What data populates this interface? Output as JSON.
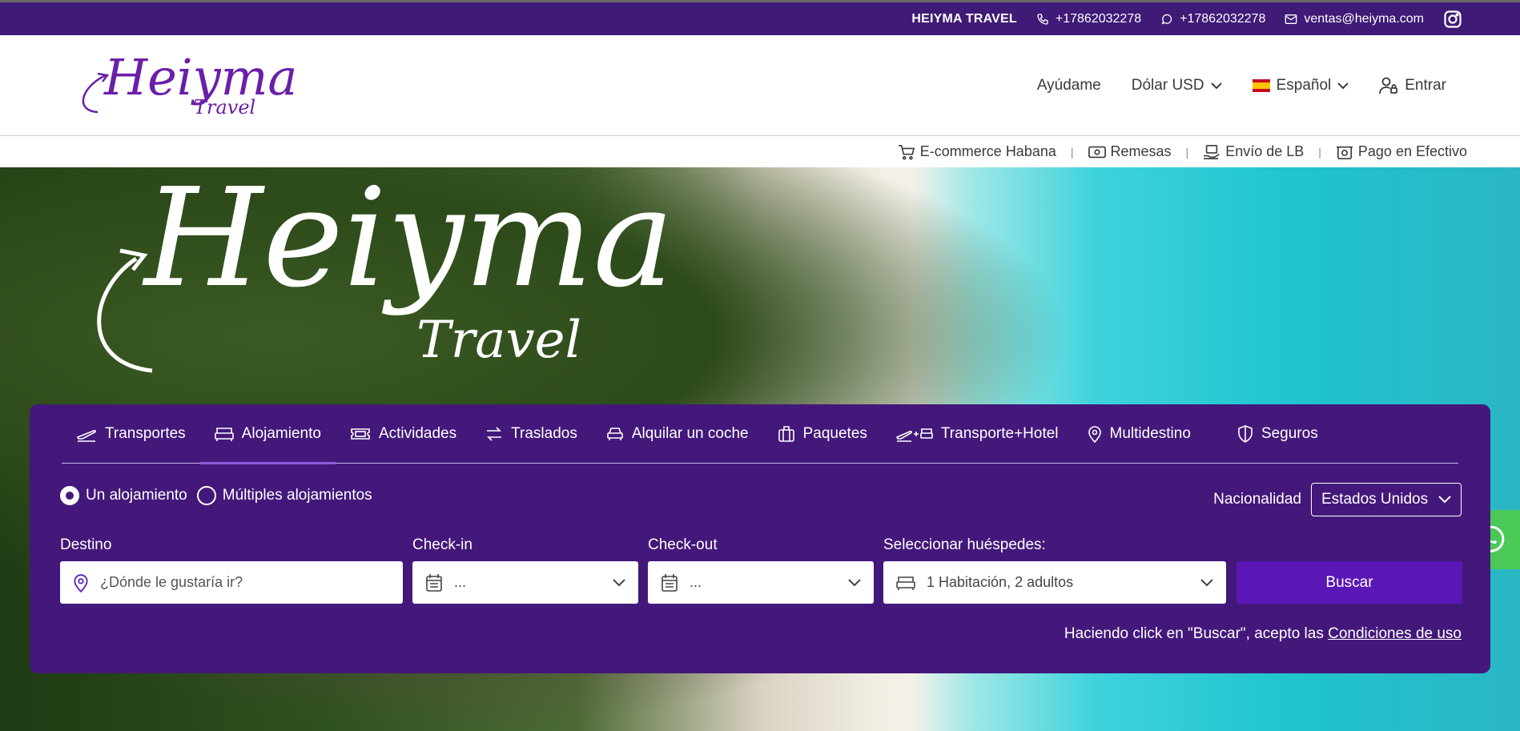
{
  "topbar": {
    "brand": "HEIYMA TRAVEL",
    "phone": "+17862032278",
    "whatsapp": "+17862032278",
    "email": "ventas@heiyma.com",
    "icons": [
      "phone-icon",
      "whatsapp-icon",
      "mail-icon",
      "instagram-icon"
    ]
  },
  "logo": {
    "main": "Heiyma",
    "sub": "Travel"
  },
  "nav": {
    "help": "Ayúdame",
    "currency": "Dólar USD",
    "language": "Español",
    "login": "Entrar"
  },
  "subnav": [
    {
      "label": "E-commerce Habana",
      "icon": "cart-icon"
    },
    {
      "label": "Remesas",
      "icon": "money-icon"
    },
    {
      "label": "Envío de LB",
      "icon": "shipping-icon"
    },
    {
      "label": "Pago en Efectivo",
      "icon": "cash-icon"
    }
  ],
  "hero": {
    "logo_main": "Heiyma",
    "logo_sub": "Travel"
  },
  "tabs": [
    {
      "label": "Transportes",
      "icon": "plane-icon",
      "active": false
    },
    {
      "label": "Alojamiento",
      "icon": "bed-icon",
      "active": true
    },
    {
      "label": "Actividades",
      "icon": "ticket-icon",
      "active": false
    },
    {
      "label": "Traslados",
      "icon": "transfer-icon",
      "active": false
    },
    {
      "label": "Alquilar un coche",
      "icon": "car-icon",
      "active": false
    },
    {
      "label": "Paquetes",
      "icon": "suitcase-icon",
      "active": false
    },
    {
      "label": "Transporte+Hotel",
      "icon": "plane-bed-icon",
      "active": false
    },
    {
      "label": "Multidestino",
      "icon": "location-icon",
      "active": false
    },
    {
      "label": "Seguros",
      "icon": "shield-icon",
      "active": false
    }
  ],
  "search": {
    "radio_single": "Un alojamiento",
    "radio_multiple": "Múltiples alojamientos",
    "nationality_label": "Nacionalidad",
    "nationality_value": "Estados Unidos",
    "destination_label": "Destino",
    "destination_placeholder": "¿Dónde le gustaría ir?",
    "checkin_label": "Check-in",
    "checkin_value": "...",
    "checkout_label": "Check-out",
    "checkout_value": "...",
    "guests_label": "Seleccionar huéspedes:",
    "guests_value": "1 Habitación, 2 adultos",
    "search_button": "Buscar",
    "terms_text": "Haciendo click en \"Buscar\", acepto las",
    "terms_link": "Condiciones de uso"
  },
  "colors": {
    "topbar": "#3f1a76",
    "panel": "#43187a",
    "button": "#5a17b6",
    "logo": "#6a1fa8",
    "whatsapp": "#4ac959"
  }
}
